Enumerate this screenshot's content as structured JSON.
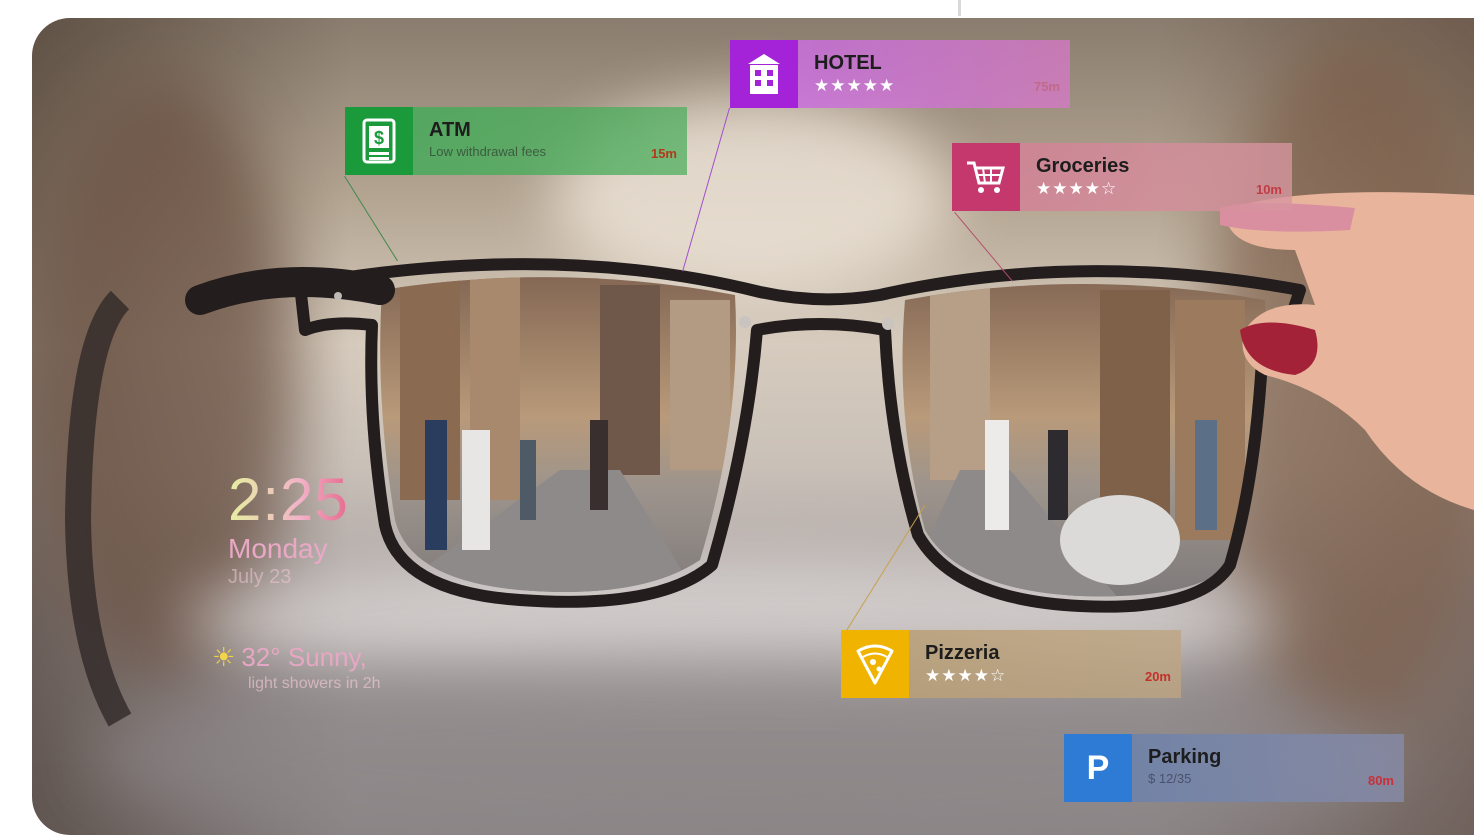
{
  "colors": {
    "atm": "#1aa03c",
    "hotel": "#a423d8",
    "groceries": "#c5386e",
    "pizzeria": "#f0b400",
    "parking": "#2e7bd6"
  },
  "hud": {
    "time": "2:25",
    "day": "Monday",
    "date": "July 23",
    "weather_temp": "32° Sunny,",
    "weather_detail": "light showers in 2h",
    "weather_icon": "sun-icon"
  },
  "pois": [
    {
      "id": "atm",
      "icon": "dollar-bill-icon",
      "title": "ATM",
      "subtitle": "Low withdrawal fees",
      "distance": "15m"
    },
    {
      "id": "hotel",
      "icon": "building-icon",
      "title": "HOTEL",
      "stars": "★★★★★",
      "distance": "75m"
    },
    {
      "id": "groceries",
      "icon": "shopping-cart-icon",
      "title": "Groceries",
      "stars": "★★★★☆",
      "distance": "10m"
    },
    {
      "id": "pizzeria",
      "icon": "pizza-icon",
      "title": "Pizzeria",
      "stars": "★★★★☆",
      "distance": "20m"
    },
    {
      "id": "parking",
      "icon": "parking-icon",
      "icon_letter": "P",
      "title": "Parking",
      "subtitle": "$ 12/35",
      "distance": "80m"
    }
  ]
}
